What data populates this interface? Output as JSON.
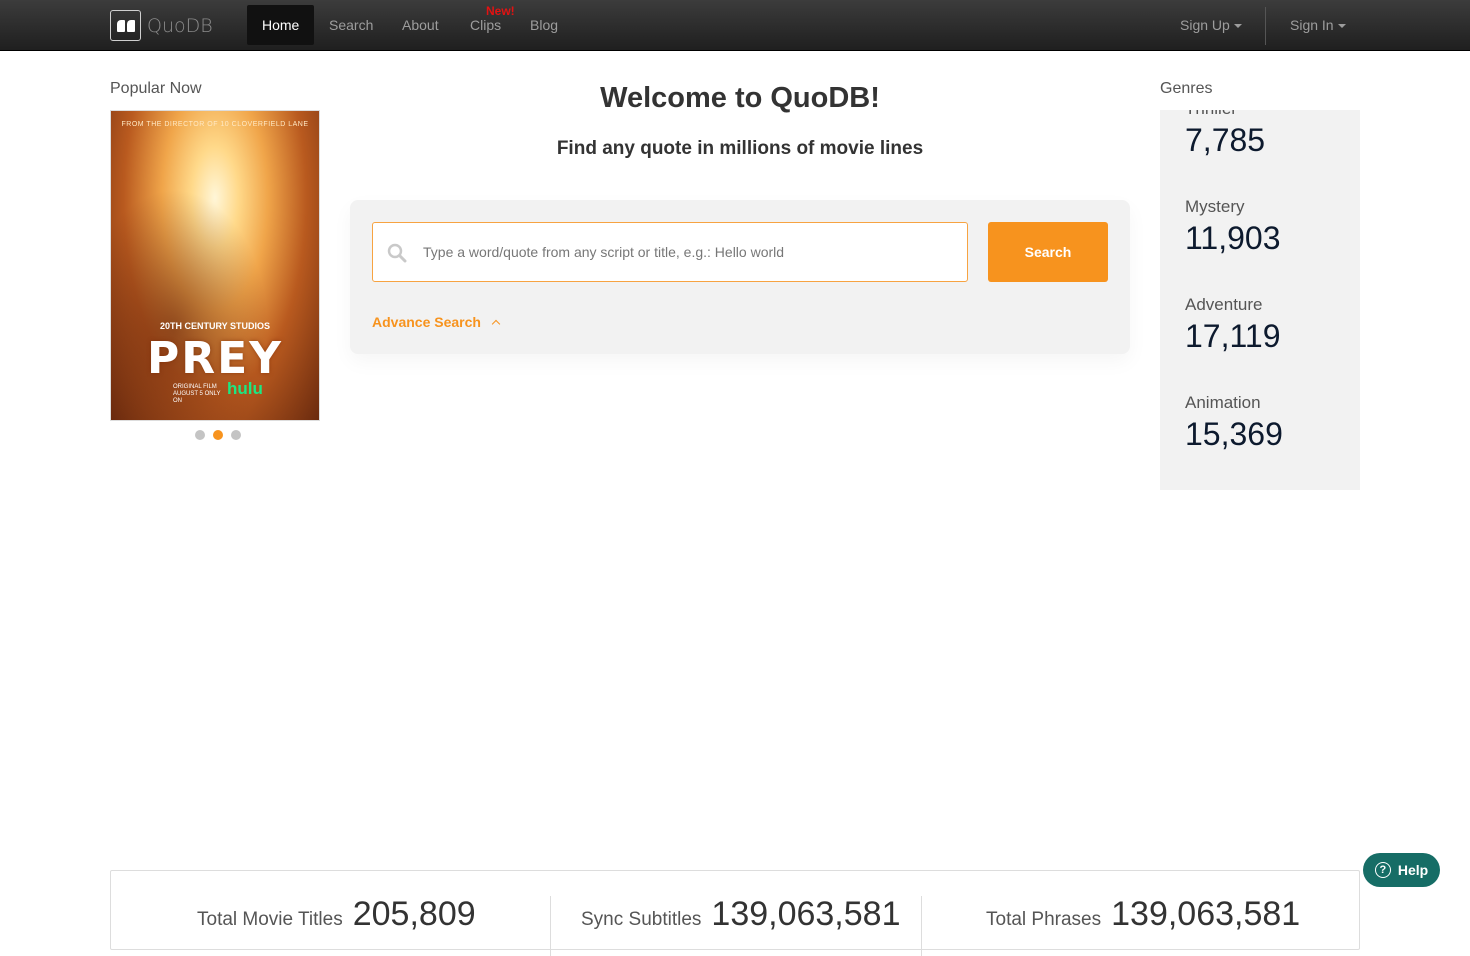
{
  "brand": {
    "name": "QuoDB",
    "logo_icon": "quote-marks-icon"
  },
  "nav": {
    "items": [
      {
        "label": "Home",
        "active": true
      },
      {
        "label": "Search"
      },
      {
        "label": "About"
      },
      {
        "label": "Clips",
        "badge": "New!"
      },
      {
        "label": "Blog"
      }
    ],
    "right": {
      "signup": "Sign Up",
      "signin": "Sign In"
    }
  },
  "popular": {
    "title": "Popular Now",
    "poster": {
      "tagline": "FROM THE DIRECTOR OF 10 CLOVERFIELD LANE",
      "studio": "20TH CENTURY STUDIOS",
      "movie_title": "PREY",
      "origin": "ORIGINAL FILM AUGUST 5 ONLY ON",
      "network": "hulu"
    },
    "carousel_active_index": 1,
    "carousel_count": 3
  },
  "main": {
    "welcome": "Welcome to QuoDB!",
    "subtitle": "Find any quote in millions of movie lines",
    "search_placeholder": "Type a word/quote from any script or title, e.g.: Hello world",
    "search_button": "Search",
    "advance_search": "Advance Search"
  },
  "genres": {
    "title": "Genres",
    "items": [
      {
        "name": "Thriller",
        "count": "7,785"
      },
      {
        "name": "Mystery",
        "count": "11,903"
      },
      {
        "name": "Adventure",
        "count": "17,119"
      },
      {
        "name": "Animation",
        "count": "15,369"
      }
    ]
  },
  "stats": [
    {
      "label": "Total Movie Titles",
      "value": "205,809"
    },
    {
      "label": "Sync Subtitles",
      "value": "139,063,581"
    },
    {
      "label": "Total Phrases",
      "value": "139,063,581"
    }
  ],
  "help": {
    "label": "Help",
    "icon": "question-icon"
  },
  "colors": {
    "accent": "#f7931e",
    "help": "#166d66",
    "badge": "#e31212"
  }
}
